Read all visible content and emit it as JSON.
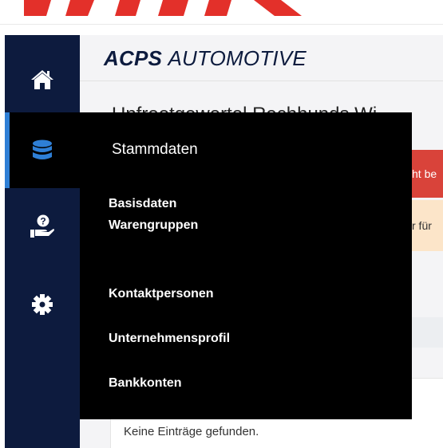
{
  "brand": {
    "bold": "ACPS",
    "light": "AUTOMOTIVE"
  },
  "heading": "Unfreetgewertel Rechhunds Wi",
  "alerts": {
    "error_text": "ht be",
    "warning_text": "r für"
  },
  "table": {
    "empty_message": "Keine Einträge gefunden."
  },
  "sidebar": {
    "items": [
      {
        "name": "home",
        "icon": "home-icon"
      },
      {
        "name": "stammdaten",
        "icon": "database-icon",
        "active": true
      },
      {
        "name": "help",
        "icon": "hand-question-icon"
      },
      {
        "name": "settings",
        "icon": "gear-icon"
      }
    ]
  },
  "flyout": {
    "title": "Stammdaten",
    "items": [
      {
        "label": "Basisdaten"
      },
      {
        "label": "Warengruppen"
      },
      {
        "label": "Kontaktpersonen"
      },
      {
        "label": "Unternehmensprofil"
      },
      {
        "label": "Bankkonten"
      }
    ]
  },
  "colors": {
    "sidebar_bg": "#0d1b3e",
    "active_accent": "#2e7fd6",
    "logo_red": "#e3302a",
    "alert_error": "#d9433a",
    "alert_warning": "#fce5c9"
  }
}
